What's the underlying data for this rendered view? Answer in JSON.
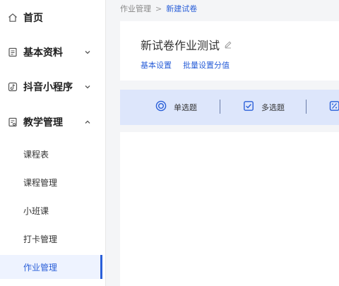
{
  "sidebar": {
    "items": [
      {
        "label": "首页",
        "icon": "home-icon"
      },
      {
        "label": "基本资料",
        "icon": "document-icon",
        "expanded": false
      },
      {
        "label": "抖音小程序",
        "icon": "tiktok-icon",
        "expanded": false
      },
      {
        "label": "教学管理",
        "icon": "clipboard-icon",
        "expanded": true
      }
    ],
    "subitems": [
      {
        "label": "课程表"
      },
      {
        "label": "课程管理"
      },
      {
        "label": "小班课"
      },
      {
        "label": "打卡管理"
      },
      {
        "label": "作业管理",
        "active": true
      }
    ]
  },
  "breadcrumb": {
    "parent": "作业管理",
    "separator": ">",
    "current": "新建试卷"
  },
  "page": {
    "title": "新试卷作业测试",
    "tabs": [
      "基本设置",
      "批量设置分值"
    ]
  },
  "question_types": [
    {
      "label": "单选题",
      "icon": "radio-circle-icon"
    },
    {
      "label": "多选题",
      "icon": "checkbox-icon"
    },
    {
      "label": "",
      "icon": "percent-icon"
    }
  ],
  "colors": {
    "accent": "#2a5fd8",
    "active_bg": "#eef3ff",
    "toolbar_bg": "#dde6fb"
  }
}
